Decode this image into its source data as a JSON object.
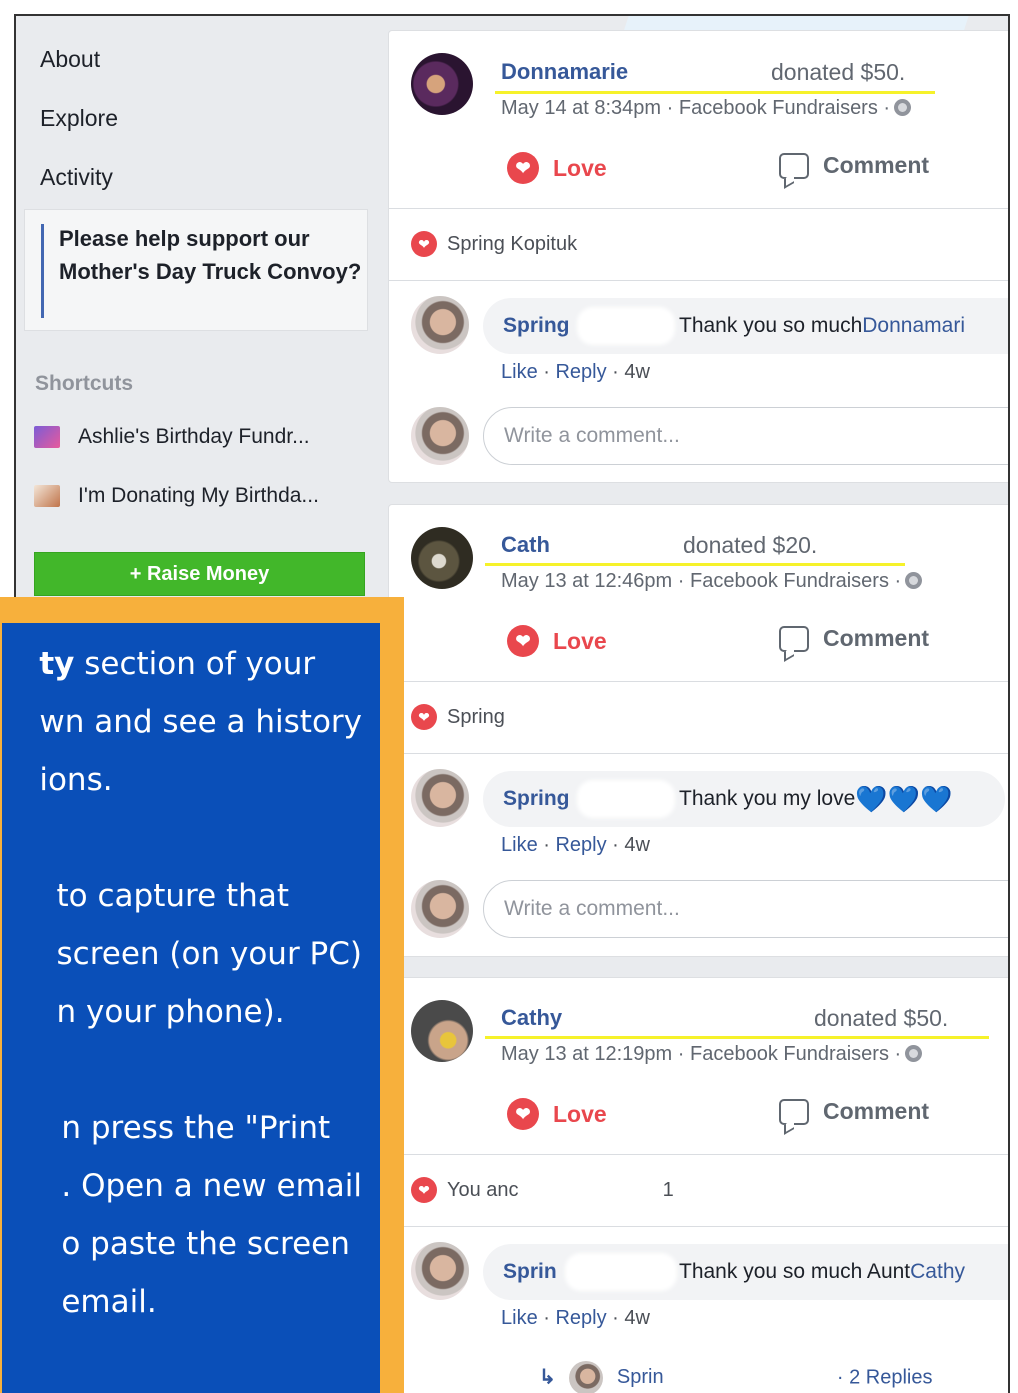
{
  "sidebar": {
    "links": [
      "About",
      "Explore",
      "Activity"
    ],
    "fundraiser_prompt": "Please help support our Mother's Day Truck Convoy?",
    "shortcuts_heading": "Shortcuts",
    "shortcuts": [
      {
        "label": "Ashlie's Birthday Fundr...",
        "icon": "fundraiser-thumbnail-icon"
      },
      {
        "label": "I'm Donating My Birthda...",
        "icon": "fundraiser-thumbnail-icon"
      }
    ],
    "raise_money_label": "+ Raise Money"
  },
  "posts": [
    {
      "donor": "Donnamarie",
      "donation": "donated $50.",
      "meta": "May 14 at 8:34pm · Facebook Fundraisers ·",
      "love_label": "Love",
      "comment_label": "Comment",
      "reactions": "Spring Kopituk",
      "comment": {
        "author": "Spring",
        "text": "Thank you so much ",
        "mention": "Donnamari",
        "actions": [
          "Like",
          "Reply",
          "4w"
        ]
      },
      "write_placeholder": "Write a comment..."
    },
    {
      "donor": "Cath",
      "donation": "donated $20.",
      "meta": "May 13 at 12:46pm · Facebook Fundraisers ·",
      "love_label": "Love",
      "comment_label": "Comment",
      "reactions": "Spring",
      "comment": {
        "author": "Spring",
        "text": "Thank you my love ",
        "mention": "💙💙💙",
        "actions": [
          "Like",
          "Reply",
          "4w"
        ]
      },
      "write_placeholder": "Write a comment..."
    },
    {
      "donor": "Cathy",
      "donation": "donated $50.",
      "meta": "May 13 at 12:19pm · Facebook Fundraisers ·",
      "love_label": "Love",
      "comment_label": "Comment",
      "reactions": "You anc",
      "reactions_tail": "1",
      "comment": {
        "author": "Sprin",
        "text": "Thank you so much Aunt ",
        "mention": "Cathy",
        "actions": [
          "Like",
          "Reply",
          "4w"
        ]
      },
      "reply_summary": {
        "author": "Sprin",
        "count": "· 2 Replies"
      }
    }
  ],
  "instructions": {
    "p1_bold": "ty",
    "p1_rest": " section of your",
    "p1_l2": "wn and see a history",
    "p1_l3": "ions.",
    "p2_l1": "to capture that",
    "p2_l2": "screen (on your PC)",
    "p2_l3": "n your phone).",
    "p3_l1": "n press the \"Print",
    "p3_l2": ". Open a new email",
    "p3_l3": "o paste the screen",
    "p3_l4": "email."
  },
  "colors": {
    "accent": "#365899",
    "love": "#e9474d",
    "raise_green": "#42b72a",
    "panel_blue": "#0a4fb8",
    "panel_border": "#f7b03c",
    "highlight": "#f6f22a"
  }
}
